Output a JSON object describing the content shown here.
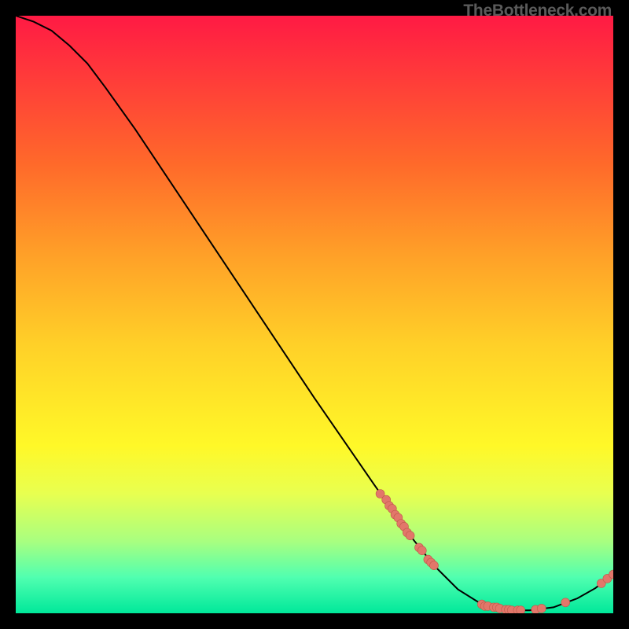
{
  "watermark": "TheBottleneck.com",
  "colors": {
    "dot_fill": "#e2776a",
    "dot_stroke": "#c05a4a",
    "curve": "#000000"
  },
  "chart_data": {
    "type": "line",
    "title": "",
    "xlabel": "",
    "ylabel": "",
    "xlim": [
      0,
      100
    ],
    "ylim": [
      0,
      100
    ],
    "curve": [
      {
        "x": 0,
        "y": 100
      },
      {
        "x": 3,
        "y": 99
      },
      {
        "x": 6,
        "y": 97.5
      },
      {
        "x": 9,
        "y": 95
      },
      {
        "x": 12,
        "y": 92
      },
      {
        "x": 15,
        "y": 88
      },
      {
        "x": 20,
        "y": 81
      },
      {
        "x": 30,
        "y": 66
      },
      {
        "x": 40,
        "y": 51
      },
      {
        "x": 50,
        "y": 36
      },
      {
        "x": 60,
        "y": 21.5
      },
      {
        "x": 66,
        "y": 13
      },
      {
        "x": 70,
        "y": 8
      },
      {
        "x": 74,
        "y": 4
      },
      {
        "x": 78,
        "y": 1.5
      },
      {
        "x": 82,
        "y": 0.5
      },
      {
        "x": 86,
        "y": 0.5
      },
      {
        "x": 90,
        "y": 1
      },
      {
        "x": 94,
        "y": 2.5
      },
      {
        "x": 97,
        "y": 4.2
      },
      {
        "x": 100,
        "y": 6.5
      }
    ],
    "points": [
      {
        "x": 61,
        "y": 20
      },
      {
        "x": 62,
        "y": 19
      },
      {
        "x": 62.5,
        "y": 18
      },
      {
        "x": 63,
        "y": 17.5
      },
      {
        "x": 63.5,
        "y": 16.5
      },
      {
        "x": 64,
        "y": 16
      },
      {
        "x": 64.5,
        "y": 15
      },
      {
        "x": 65,
        "y": 14.5
      },
      {
        "x": 65.5,
        "y": 13.5
      },
      {
        "x": 66,
        "y": 13
      },
      {
        "x": 67.5,
        "y": 11
      },
      {
        "x": 68,
        "y": 10.5
      },
      {
        "x": 69,
        "y": 9
      },
      {
        "x": 69.5,
        "y": 8.5
      },
      {
        "x": 70,
        "y": 8
      },
      {
        "x": 78,
        "y": 1.5
      },
      {
        "x": 78.5,
        "y": 1.2
      },
      {
        "x": 79,
        "y": 1.2
      },
      {
        "x": 80,
        "y": 1
      },
      {
        "x": 80.5,
        "y": 1
      },
      {
        "x": 81,
        "y": 0.8
      },
      {
        "x": 82,
        "y": 0.6
      },
      {
        "x": 82.5,
        "y": 0.6
      },
      {
        "x": 83,
        "y": 0.5
      },
      {
        "x": 84,
        "y": 0.5
      },
      {
        "x": 84.5,
        "y": 0.5
      },
      {
        "x": 87,
        "y": 0.6
      },
      {
        "x": 88,
        "y": 0.8
      },
      {
        "x": 92,
        "y": 1.8
      },
      {
        "x": 98,
        "y": 5
      },
      {
        "x": 99,
        "y": 5.8
      },
      {
        "x": 100,
        "y": 6.5
      }
    ]
  }
}
